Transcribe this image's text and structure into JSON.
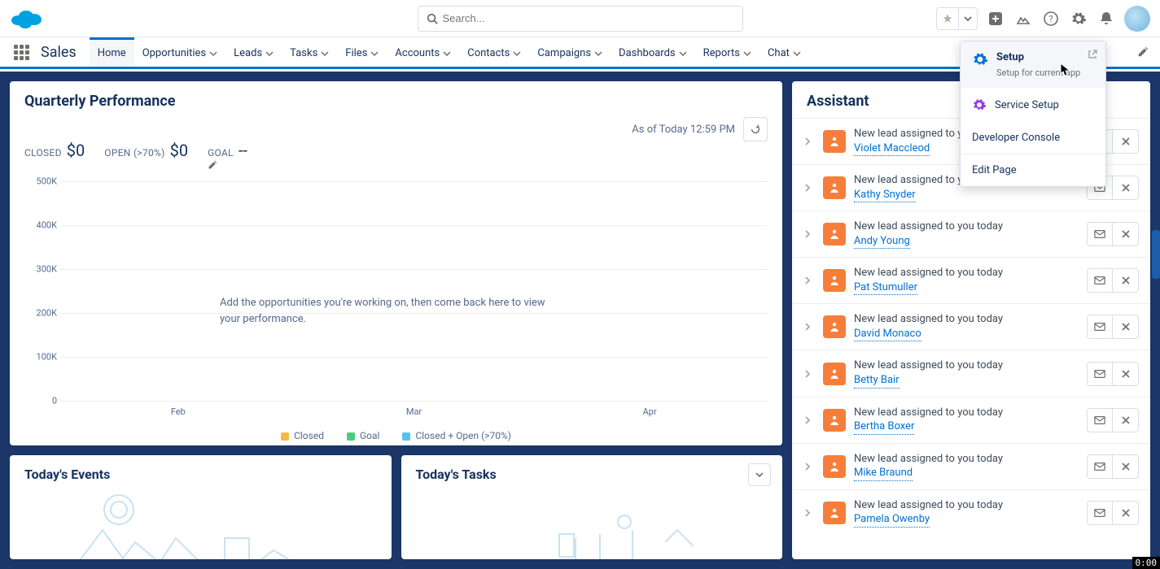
{
  "search": {
    "placeholder": "Search..."
  },
  "app_name": "Sales",
  "nav_tabs": [
    "Home",
    "Opportunities",
    "Leads",
    "Tasks",
    "Files",
    "Accounts",
    "Contacts",
    "Campaigns",
    "Dashboards",
    "Reports",
    "Chat"
  ],
  "perf": {
    "title": "Quarterly Performance",
    "as_of": "As of Today 12:59 PM",
    "closed_label": "CLOSED",
    "closed_value": "$0",
    "open_label": "OPEN (>70%)",
    "open_value": "$0",
    "goal_label": "GOAL",
    "goal_value": "--",
    "empty_msg": "Add the opportunities you're working on, then come back here to view your performance."
  },
  "chart_data": {
    "type": "bar",
    "categories": [
      "Feb",
      "Mar",
      "Apr"
    ],
    "series": [
      {
        "name": "Closed",
        "color": "#f4b942",
        "values": [
          0,
          0,
          0
        ]
      },
      {
        "name": "Goal",
        "color": "#4bca81",
        "values": [
          0,
          0,
          0
        ]
      },
      {
        "name": "Closed + Open (>70%)",
        "color": "#54c2f0",
        "values": [
          0,
          0,
          0
        ]
      }
    ],
    "y_ticks": [
      "0",
      "100K",
      "200K",
      "300K",
      "400K",
      "500K"
    ],
    "ylim": [
      0,
      500000
    ]
  },
  "events_card_title": "Today's Events",
  "tasks_card_title": "Today's Tasks",
  "assistant": {
    "title": "Assistant",
    "msg": "New lead assigned to you today",
    "leads": [
      "Violet Maccleod",
      "Kathy Snyder",
      "Andy Young",
      "Pat Stumuller",
      "David Monaco",
      "Betty Bair",
      "Bertha Boxer",
      "Mike Braund",
      "Pamela Owenby"
    ]
  },
  "setup_menu": {
    "setup": "Setup",
    "setup_sub": "Setup for current app",
    "service": "Service Setup",
    "dev": "Developer Console",
    "edit": "Edit Page"
  },
  "timer": "0:00"
}
